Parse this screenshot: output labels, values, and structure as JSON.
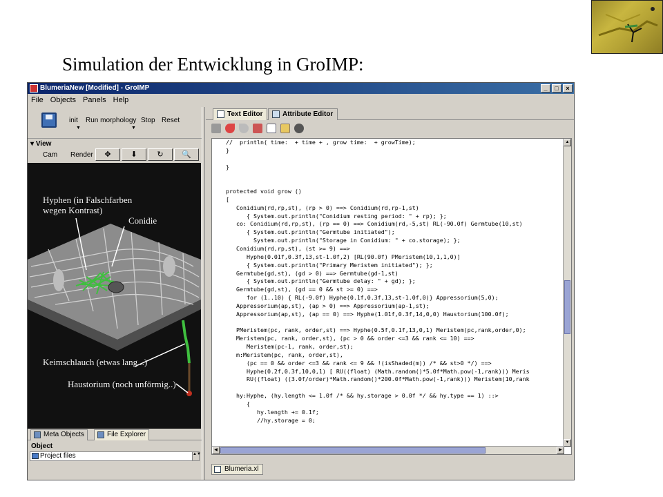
{
  "slide": {
    "title": "Simulation der Entwicklung in GroIMP:"
  },
  "window": {
    "title": "BlumeriaNew [Modified] - GroIMP",
    "controls": [
      "_",
      "□",
      "×"
    ]
  },
  "menu": [
    {
      "label": "File",
      "name": "menu-file"
    },
    {
      "label": "Objects",
      "name": "menu-objects"
    },
    {
      "label": "Panels",
      "name": "menu-panels"
    },
    {
      "label": "Help",
      "name": "menu-help"
    }
  ],
  "toolbar": {
    "init": "init",
    "run_morphology": "Run morphology",
    "stop": "Stop",
    "reset": "Reset"
  },
  "view": {
    "header": "View",
    "cam": "Cam",
    "render": "Render",
    "buttons": [
      "✥",
      "⬇",
      "↻",
      "🔍"
    ]
  },
  "viewport_labels": {
    "hyphen": "Hyphen (in Falschfarben\nwegen Kontrast)",
    "conidie": "Conidie",
    "keimschlauch": "Keimschlauch (etwas lang...)",
    "haustorium": "Haustorium (noch unförmig..)"
  },
  "bottom_panel": {
    "tabs": [
      "Meta Objects",
      "File Explorer"
    ],
    "column": "Object",
    "row": "Project files"
  },
  "editor": {
    "tabs": [
      "Text Editor",
      "Attribute Editor"
    ],
    "file_tab": "Blumeria.xl",
    "code": "//  println( time:  + time + , grow time:  + growTime);\n}\n\n}\n\n\nprotected void grow ()\n[\n   Conidium(rd,rp,st), (rp > 0) ==> Conidium(rd,rp-1,st)\n      { System.out.println(\"Conidium resting period: \" + rp); };\n   co: Conidium(rd,rp,st), (rp == 0) ==> Conidium(rd,-5,st) RL(-90.0f) Germtube(10,st)\n      { System.out.println(\"Germtube initiated\");\n        System.out.println(\"Storage in Conidium: \" + co.storage); };\n   Conidium(rd,rp,st), (st >= 9) ==>\n      Hyphe(0.01f,0.3f,13,st-1.0f,2) [RL(90.0f) PMeristem(10,1,1,0)]\n      { System.out.println(\"Primary Meristem initiated\"); };\n   Germtube(gd,st), (gd > 0) ==> Germtube(gd-1,st)\n      { System.out.println(\"Germtube delay: \" + gd); };\n   Germtube(gd,st), (gd == 0 && st >= 0) ==>\n      for (1..10) { RL(-9.0f) Hyphe(0.1f,0.3f,13,st-1.0f,0)} Appressorium(5,0);\n   Appressorium(ap,st), (ap > 0) ==> Appressorium(ap-1,st);\n   Appressorium(ap,st), (ap == 0) ==> Hyphe(1.01f,0.3f,14,0,0) Haustorium(100.0f);\n\n   PMeristem(pc, rank, order,st) ==> Hyphe(0.5f,0.1f,13,0,1) Meristem(pc,rank,order,0);\n   Meristem(pc, rank, order,st), (pc > 0 && order <=3 && rank <= 10) ==>\n      Meristem(pc-1, rank, order,st);\n   m:Meristem(pc, rank, order,st),\n      (pc == 0 && order <=3 && rank <= 9 && !(isShaded(m)) /* && st>0 */) ==>\n      Hyphe(0.2f,0.3f,10,0,1) [ RU((float) (Math.random()*5.0f*Math.pow(-1,rank))) Meris\n      RU((float) ((3.0f/order)*Math.random()*200.0f*Math.pow(-1,rank))) Meristem(10,rank\n\n   hy:Hyphe, (hy.length <= 1.0f /* && hy.storage > 0.0f */ && hy.type == 1) ::>\n      {\n         hy.length += 0.1f;\n         //hy.storage = 0;"
  }
}
